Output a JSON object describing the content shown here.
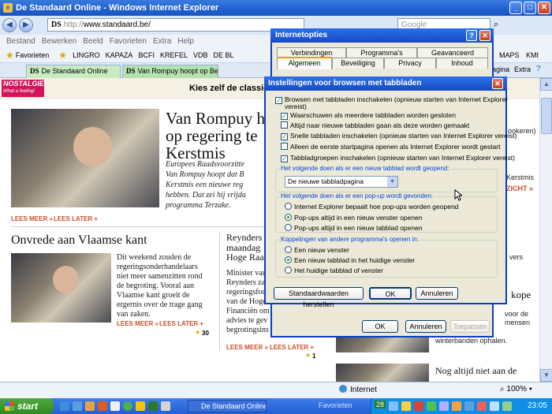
{
  "window": {
    "title": "De Standaard Online - Windows Internet Explorer"
  },
  "address": {
    "ds": "DS",
    "prefix": "http://",
    "url": "www.standaard.be/",
    "search_placeholder": "Google"
  },
  "menu": [
    "Bestand",
    "Bewerken",
    "Beeld",
    "Favorieten",
    "Extra",
    "Help"
  ],
  "favorites": [
    "Favorieten",
    "LINGRO",
    "KAPAZA",
    "BCFI",
    "KREFEL",
    "VDB",
    "DE BL",
    "MAPS",
    "KMI"
  ],
  "tabs": [
    {
      "ds": "DS",
      "label": "De Standaard Online"
    },
    {
      "ds": "DS",
      "label": "Van Rompuy hoopt op Belgis..."
    }
  ],
  "toolbar_right": [
    "Pagina",
    "Extra"
  ],
  "page": {
    "banner": {
      "logo": "NOSTALGIE",
      "logo_sub": "What a feeling!",
      "text": "Kies zelf de classics"
    },
    "story1": {
      "headline_lines": [
        "Van Rompuy h",
        "op regering te",
        "Kerstmis"
      ],
      "teaser": "Europees Raadsvoorzitte\nVan Rompuy hoopt dat B\nKerstmis een nieuwe reg\nhebben. Dat zei hij vrijda\nprogramma Terzake.",
      "lees_meer": "LEES MEER »",
      "lees_later": "LEES LATER +"
    },
    "story2": {
      "headline": "Onvrede aan Vlaamse kant",
      "body": "Dit weekend zouden de\nregeringsonderhandelaars\nniet meer samenzitten rond\nde begroting. Vooral aan\nVlaamse kant groeit de\nergernis over de trage gang\nvan zaken.",
      "lees_meer": "LEES MEER »",
      "lees_later": "LEES LATER +",
      "comments": "30"
    },
    "story3": {
      "headline_lines": [
        "Reynders",
        "maandag",
        "Hoge Raa"
      ],
      "body": "Minister van\nReynders za\nregeringsfor\nvan de Hoge\nFinanciën om\nadvies te gev\nbegrotingsins",
      "lees_meer": "LEES MEER »",
      "lees_later": "LEES LATER +",
      "comments": "1"
    },
    "right_col": {
      "r1": "ookeren)",
      "r2": "Kerstmis",
      "r3": "ZICHT »",
      "r4": "vers",
      "r5": "kope",
      "r6": "voor de\nmensen",
      "r7": "winterbanden ophalen.",
      "r8": "Nog altijd niet aan de"
    }
  },
  "status": {
    "zone": "Internet",
    "zoom": "100%"
  },
  "taskbar": {
    "start": "start",
    "task": "De Standaard Online ...",
    "favorieten": "Favorieten",
    "clock": "23:05",
    "tray_badge": "28"
  },
  "internet_options": {
    "title": "Internetopties",
    "tabs_row1": [
      "Verbindingen",
      "Programma's",
      "Geavanceerd"
    ],
    "tabs_row2": [
      "Algemeen",
      "Beveiliging",
      "Privacy",
      "Inhoud"
    ],
    "ok": "OK",
    "cancel": "Annuleren",
    "apply": "Toepassen"
  },
  "tab_settings": {
    "title": "Instellingen voor browsen met tabbladen",
    "checks": [
      {
        "label": "Browsen met tabbladen inschakelen (opnieuw starten van Internet Explorer",
        "label2": "vereist)",
        "checked": true
      },
      {
        "label": "Waarschuwen als meerdere tabbladen worden gesloten",
        "checked": true
      },
      {
        "label": "Altijd naar nieuwe tabbladen gaan als deze worden gemaakt",
        "checked": false
      },
      {
        "label": "Snelle tabbladen inschakelen (opnieuw starten van Internet Explorer vereist)",
        "checked": true
      },
      {
        "label": "Alleen de eerste startpagina openen als Internet Explorer wordt gestart",
        "checked": false
      },
      {
        "label": "Tabbladgroepen inschakelen (opnieuw starten van Internet Explorer vereist)",
        "checked": true
      }
    ],
    "newtab_group": "Het volgende doen als er een nieuw tabblad wordt geopend:",
    "newtab_value": "De nieuwe tabbladpagina",
    "popup_group": "Het volgende doen als er een pop-up wordt gevonden:",
    "popup_options": [
      {
        "label": "Internet Explorer bepaalt hoe pop-ups worden geopend",
        "selected": false
      },
      {
        "label": "Pop-ups altijd in een nieuw venster openen",
        "selected": true
      },
      {
        "label": "Pop-ups altijd in een nieuw tabblad openen",
        "selected": false
      }
    ],
    "links_group": "Koppelingen van andere programma's openen in:",
    "links_options": [
      {
        "label": "Een nieuw venster",
        "selected": false
      },
      {
        "label": "Een nieuw tabblad in het huidige venster",
        "selected": true
      },
      {
        "label": "Het huidige tabblad of venster",
        "selected": false
      }
    ],
    "restore": "Standaardwaarden herstellen",
    "ok": "OK",
    "cancel": "Annuleren"
  }
}
